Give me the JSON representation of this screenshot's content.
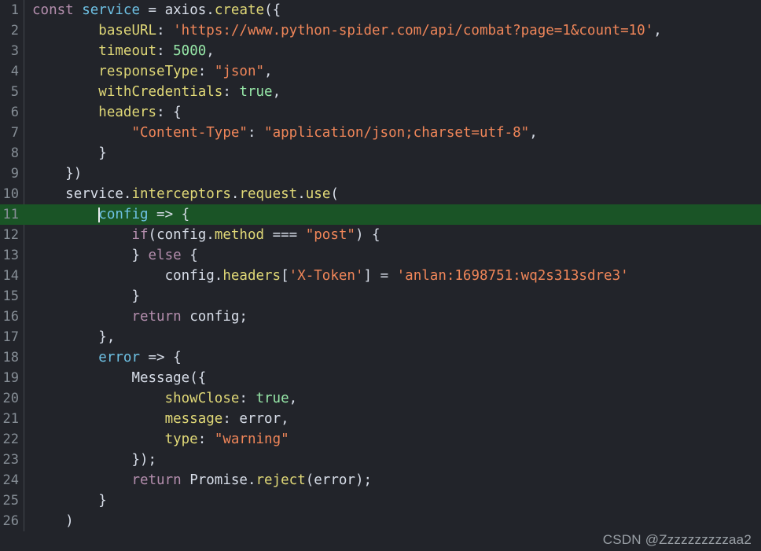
{
  "editor": {
    "background": "#22242a",
    "gutter_color": "#868e96",
    "highlight_color": "#1a5426",
    "highlighted_line": 11,
    "cursor_line": 11,
    "cursor_column": 9
  },
  "theme": {
    "keyword": "#b48ead",
    "variable": "#6ec1e4",
    "property": "#e0d877",
    "string": "#f08659",
    "number": "#97e8a8",
    "boolean": "#97e8a8",
    "plain": "#d8dee9"
  },
  "line_numbers": [
    1,
    2,
    3,
    4,
    5,
    6,
    7,
    8,
    9,
    10,
    11,
    12,
    13,
    14,
    15,
    16,
    17,
    18,
    19,
    20,
    21,
    22,
    23,
    24,
    25,
    26
  ],
  "code_lines": [
    {
      "n": 1,
      "text": "const service = axios.create({"
    },
    {
      "n": 2,
      "text": "        baseURL: 'https://www.python-spider.com/api/combat?page=1&count=10',"
    },
    {
      "n": 3,
      "text": "        timeout: 5000,"
    },
    {
      "n": 4,
      "text": "        responseType: \"json\","
    },
    {
      "n": 5,
      "text": "        withCredentials: true,"
    },
    {
      "n": 6,
      "text": "        headers: {"
    },
    {
      "n": 7,
      "text": "            \"Content-Type\": \"application/json;charset=utf-8\","
    },
    {
      "n": 8,
      "text": "        }"
    },
    {
      "n": 9,
      "text": "    })"
    },
    {
      "n": 10,
      "text": "    service.interceptors.request.use("
    },
    {
      "n": 11,
      "text": "        config => {"
    },
    {
      "n": 12,
      "text": "            if(config.method === \"post\") {"
    },
    {
      "n": 13,
      "text": "            } else {"
    },
    {
      "n": 14,
      "text": "                config.headers['X-Token'] = 'anlan:1698751:wq2s313sdre3'"
    },
    {
      "n": 15,
      "text": "            }"
    },
    {
      "n": 16,
      "text": "            return config;"
    },
    {
      "n": 17,
      "text": "        },"
    },
    {
      "n": 18,
      "text": "        error => {"
    },
    {
      "n": 19,
      "text": "            Message({"
    },
    {
      "n": 20,
      "text": "                showClose: true,"
    },
    {
      "n": 21,
      "text": "                message: error,"
    },
    {
      "n": 22,
      "text": "                type: \"warning\""
    },
    {
      "n": 23,
      "text": "            });"
    },
    {
      "n": 24,
      "text": "            return Promise.reject(error);"
    },
    {
      "n": 25,
      "text": "        }"
    },
    {
      "n": 26,
      "text": "    )"
    }
  ],
  "tokens": {
    "l1": {
      "t1": "const",
      "t2": " ",
      "t3": "service",
      "t4": " = ",
      "t5": "axios",
      "t6": ".",
      "t7": "create",
      "t8": "({"
    },
    "l2": {
      "indent": "        ",
      "key": "baseURL",
      "colon": ": ",
      "str": "'https://www.python-spider.com/api/combat?page=1&count=10'",
      "tail": ","
    },
    "l3": {
      "indent": "        ",
      "key": "timeout",
      "colon": ": ",
      "num": "5000",
      "tail": ","
    },
    "l4": {
      "indent": "        ",
      "key": "responseType",
      "colon": ": ",
      "str": "\"json\"",
      "tail": ","
    },
    "l5": {
      "indent": "        ",
      "key": "withCredentials",
      "colon": ": ",
      "bool": "true",
      "tail": ","
    },
    "l6": {
      "indent": "        ",
      "key": "headers",
      "colon": ": ",
      "tail": "{"
    },
    "l7": {
      "indent": "            ",
      "key": "\"Content-Type\"",
      "colon": ": ",
      "str": "\"application/json;charset=utf-8\"",
      "tail": ","
    },
    "l8": {
      "indent": "        ",
      "tail": "}"
    },
    "l9": {
      "indent": "    ",
      "tail": "})"
    },
    "l10": {
      "indent": "    ",
      "obj": "service",
      "d1": ".",
      "p1": "interceptors",
      "d2": ".",
      "p2": "request",
      "d3": ".",
      "p3": "use",
      "tail": "("
    },
    "l11": {
      "indent": "        ",
      "param": "config",
      "tail": " => {"
    },
    "l12": {
      "indent": "            ",
      "kw": "if",
      "open": "(",
      "obj": "config",
      "dot": ".",
      "prop": "method",
      "op": " === ",
      "str": "\"post\"",
      "tail": ") {"
    },
    "l13": {
      "indent": "            ",
      "brace": "} ",
      "kw": "else",
      "tail": " {"
    },
    "l14": {
      "indent": "                ",
      "obj": "config",
      "dot": ".",
      "prop": "headers",
      "b1": "[",
      "key": "'X-Token'",
      "b2": "]",
      "eq": " = ",
      "str": "'anlan:1698751:wq2s313sdre3'"
    },
    "l15": {
      "indent": "            ",
      "tail": "}"
    },
    "l16": {
      "indent": "            ",
      "kw": "return",
      "tail": " config;"
    },
    "l17": {
      "indent": "        ",
      "tail": "},"
    },
    "l18": {
      "indent": "        ",
      "param": "error",
      "tail": " => {"
    },
    "l19": {
      "indent": "            ",
      "fn": "Message",
      "tail": "({"
    },
    "l20": {
      "indent": "                ",
      "key": "showClose",
      "colon": ": ",
      "bool": "true",
      "tail": ","
    },
    "l21": {
      "indent": "                ",
      "key": "message",
      "colon": ": ",
      "val": "error",
      "tail": ","
    },
    "l22": {
      "indent": "                ",
      "key": "type",
      "colon": ": ",
      "str": "\"warning\""
    },
    "l23": {
      "indent": "            ",
      "tail": "});"
    },
    "l24": {
      "indent": "            ",
      "kw": "return",
      "sp": " ",
      "obj": "Promise",
      "dot": ".",
      "prop": "reject",
      "tail": "(error);"
    },
    "l25": {
      "indent": "        ",
      "tail": "}"
    },
    "l26": {
      "indent": "    ",
      "tail": ")"
    }
  },
  "watermark": {
    "text": "CSDN @Zzzzzzzzzzaa2"
  }
}
